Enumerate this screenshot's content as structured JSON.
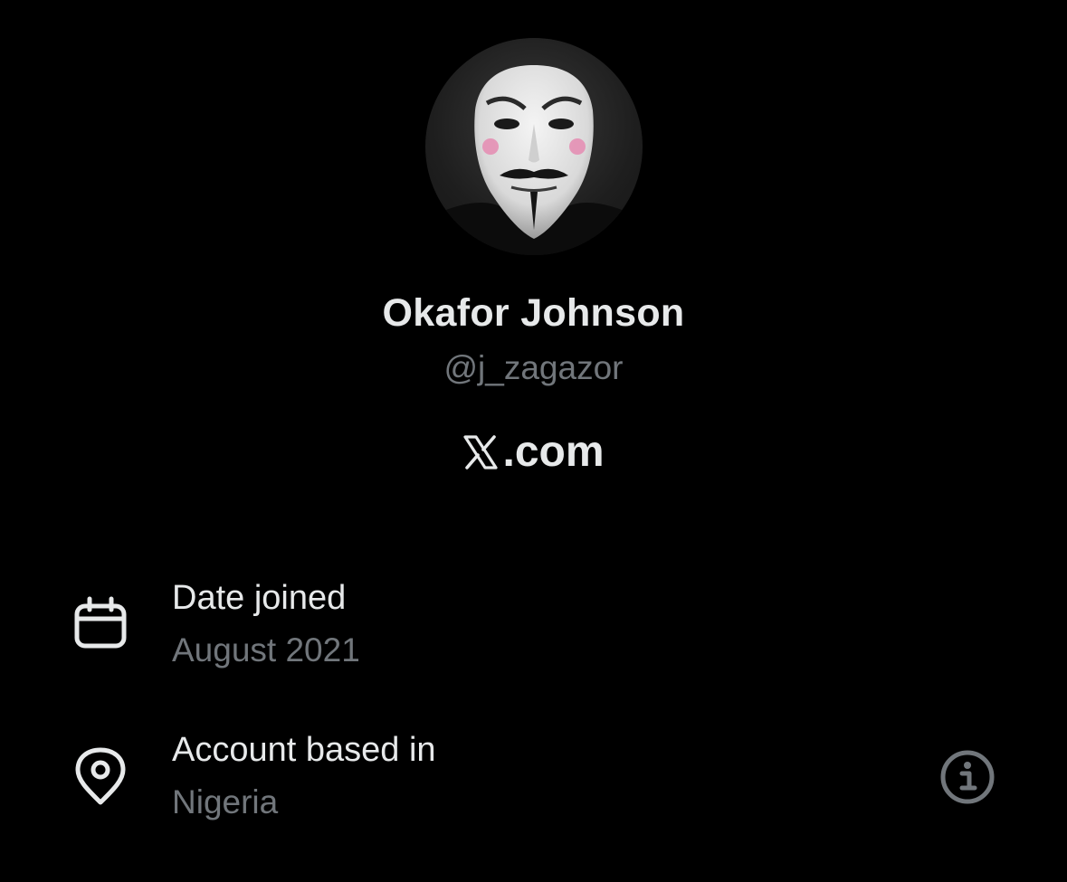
{
  "profile": {
    "display_name": "Okafor Johnson",
    "handle": "@j_zagazor",
    "avatar_icon": "anonymous-mask-avatar"
  },
  "brand": {
    "text": ".com",
    "logo_icon": "x-logo-icon"
  },
  "details": [
    {
      "icon": "calendar-icon",
      "label": "Date joined",
      "value": "August 2021"
    },
    {
      "icon": "location-pin-icon",
      "label": "Account based in",
      "value": "Nigeria",
      "action_icon": "info-icon"
    }
  ],
  "colors": {
    "background": "#000000",
    "primary_text": "#e7e9ea",
    "secondary_text": "#71767b"
  }
}
